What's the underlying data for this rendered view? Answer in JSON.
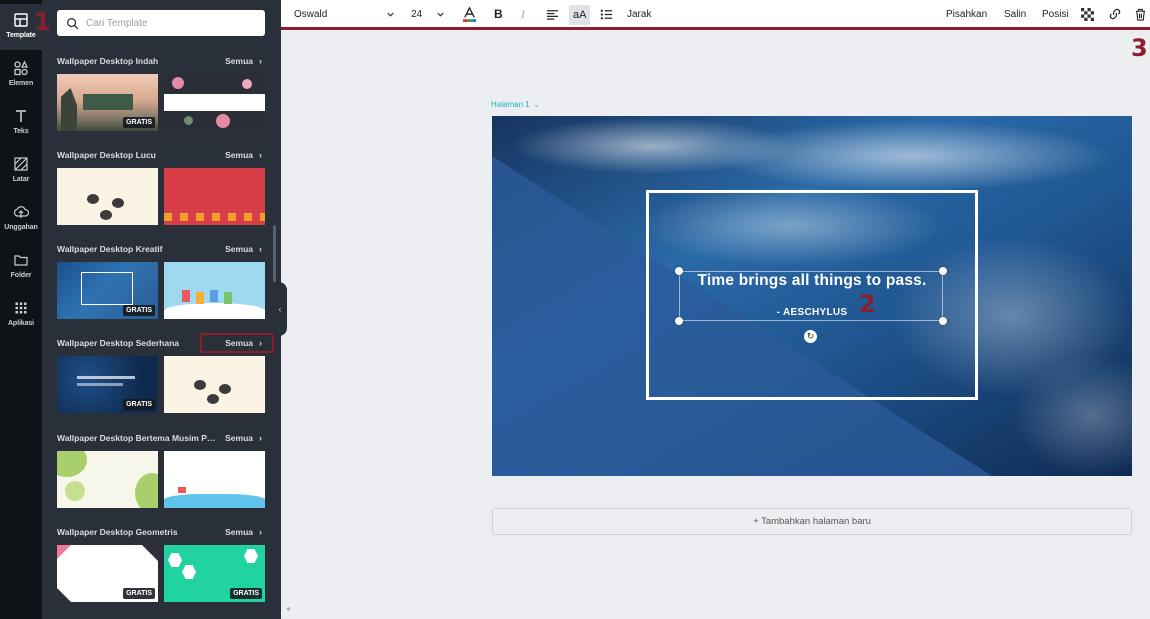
{
  "sidebar": {
    "items": [
      {
        "label": "Template",
        "icon": "template-icon"
      },
      {
        "label": "Elemen",
        "icon": "elements-icon"
      },
      {
        "label": "Teks",
        "icon": "text-icon"
      },
      {
        "label": "Latar",
        "icon": "background-icon"
      },
      {
        "label": "Unggahan",
        "icon": "upload-icon"
      },
      {
        "label": "Folder",
        "icon": "folder-icon"
      },
      {
        "label": "Aplikasi",
        "icon": "apps-icon"
      }
    ]
  },
  "panel": {
    "search_placeholder": "Cari Template",
    "see_all_label": "Semua",
    "badge_label": "GRATIS",
    "sections": [
      {
        "title": "Wallpaper Desktop Indah"
      },
      {
        "title": "Wallpaper Desktop Lucu"
      },
      {
        "title": "Wallpaper Desktop Kreatif"
      },
      {
        "title": "Wallpaper Desktop Sederhana"
      },
      {
        "title": "Wallpaper Desktop Bertema Musim Pan..."
      },
      {
        "title": "Wallpaper Desktop Geometris"
      }
    ]
  },
  "toolbar": {
    "font_name": "Oswald",
    "font_size": "24",
    "case_label": "aA",
    "spacing_label": "Jarak",
    "ungroup_label": "Pisahkan",
    "copy_label": "Salin",
    "position_label": "Posisi"
  },
  "canvas": {
    "page_label": "Halaman 1",
    "quote": "Time brings all things to pass.",
    "author": "- AESCHYLUS",
    "add_page_label": "+ Tambahkan halaman baru"
  },
  "markers": {
    "one": "1",
    "two": "2",
    "three": "3"
  },
  "colors": {
    "rail_bg": "#0e1318",
    "panel_bg": "#293039",
    "accent_red": "#8b1d2c",
    "page_label": "#1fb6c1"
  }
}
